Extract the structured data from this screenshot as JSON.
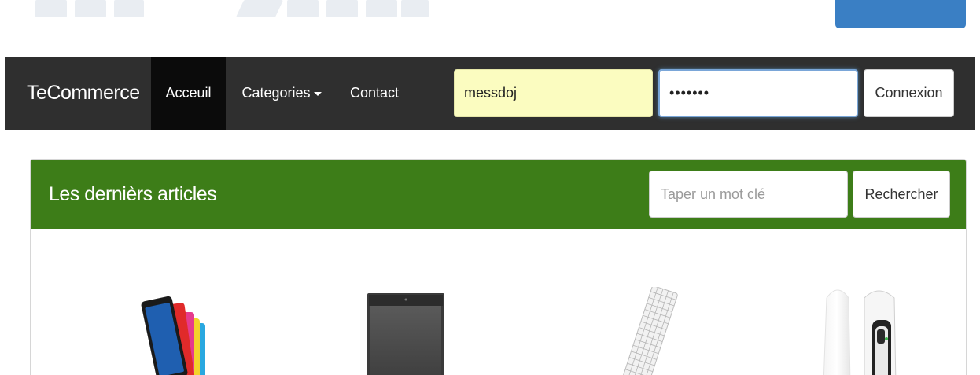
{
  "navbar": {
    "brand": "TeCommerce",
    "items": [
      {
        "label": "Acceuil",
        "active": true
      },
      {
        "label": "Categories",
        "dropdown": true
      },
      {
        "label": "Contact"
      }
    ],
    "login": {
      "username_value": "messdoj",
      "password_value": "•••••••",
      "submit_label": "Connexion"
    }
  },
  "articles": {
    "title": "Les dernièrs articles",
    "search_placeholder": "Taper un mot clé",
    "search_button": "Rechercher",
    "products": [
      {
        "icon": "tablet-image"
      },
      {
        "icon": "ereader-image"
      },
      {
        "icon": "keyboard-image"
      },
      {
        "icon": "mouse-image"
      }
    ]
  },
  "colors": {
    "navbar_bg": "#2f2f2f",
    "nav_active_bg": "#0b0b0b",
    "panel_heading_bg": "#3d7d18",
    "autofill_bg": "#fbfcc0",
    "top_button_blue": "#3a7fc4"
  }
}
